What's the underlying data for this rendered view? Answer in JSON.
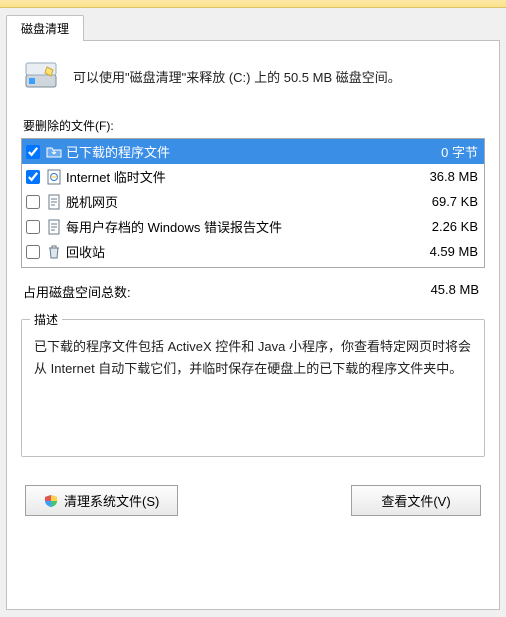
{
  "tab": {
    "label": "磁盘清理"
  },
  "intro": {
    "text": "可以使用\"磁盘清理\"来释放  (C:) 上的 50.5 MB 磁盘空间。"
  },
  "filesToDelete": {
    "label": "要删除的文件(F):",
    "items": [
      {
        "checked": true,
        "icon": "folder-download-icon",
        "name": "已下载的程序文件",
        "size": "0 字节",
        "selected": true
      },
      {
        "checked": true,
        "icon": "ie-file-icon",
        "name": "Internet 临时文件",
        "size": "36.8 MB",
        "selected": false
      },
      {
        "checked": false,
        "icon": "page-icon",
        "name": "脱机网页",
        "size": "69.7 KB",
        "selected": false
      },
      {
        "checked": false,
        "icon": "page-icon",
        "name": "每用户存档的 Windows 错误报告文件",
        "size": "2.26 KB",
        "selected": false
      },
      {
        "checked": false,
        "icon": "recycle-bin-icon",
        "name": "回收站",
        "size": "4.59 MB",
        "selected": false
      }
    ]
  },
  "total": {
    "label": "占用磁盘空间总数:",
    "value": "45.8 MB"
  },
  "description": {
    "legend": "描述",
    "text": "已下载的程序文件包括 ActiveX 控件和 Java 小程序，你查看特定网页时将会从 Internet 自动下载它们，并临时保存在硬盘上的已下载的程序文件夹中。"
  },
  "buttons": {
    "cleanSystem": "清理系统文件(S)",
    "viewFiles": "查看文件(V)"
  }
}
